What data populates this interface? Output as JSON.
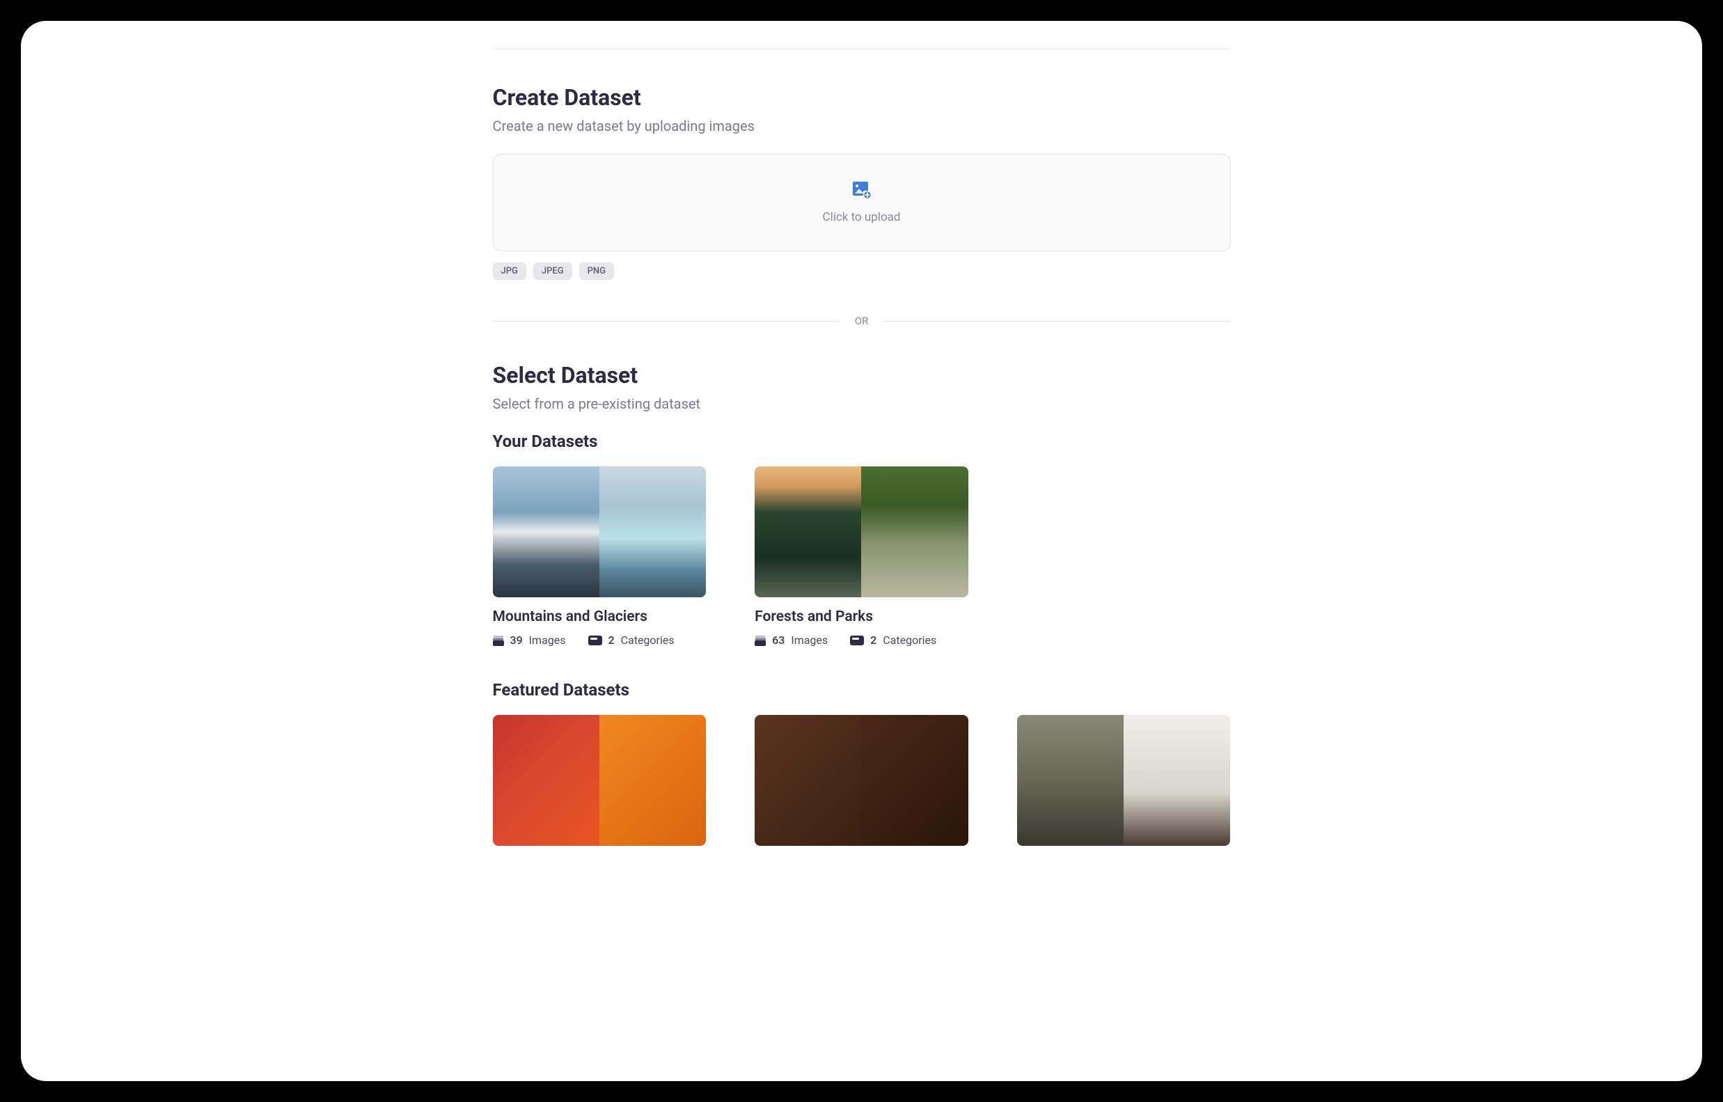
{
  "create": {
    "title": "Create Dataset",
    "subtitle": "Create a new dataset by uploading images",
    "upload_text": "Click to upload",
    "formats": [
      "JPG",
      "JPEG",
      "PNG"
    ]
  },
  "divider": "OR",
  "select": {
    "title": "Select Dataset",
    "subtitle": "Select from a pre-existing dataset"
  },
  "your_datasets": {
    "heading": "Your Datasets",
    "items": [
      {
        "title": "Mountains and Glaciers",
        "images_count": "39",
        "images_label": "Images",
        "categories_count": "2",
        "categories_label": "Categories"
      },
      {
        "title": "Forests and Parks",
        "images_count": "63",
        "images_label": "Images",
        "categories_count": "2",
        "categories_label": "Categories"
      }
    ]
  },
  "featured_datasets": {
    "heading": "Featured Datasets"
  }
}
